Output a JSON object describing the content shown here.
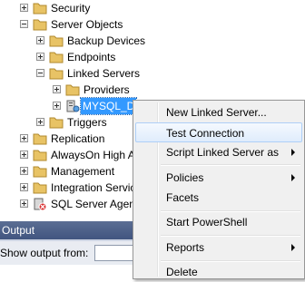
{
  "tree": {
    "items": [
      {
        "label": "Security",
        "expander": "plus",
        "icon": "folder-icon"
      },
      {
        "label": "Server Objects",
        "expander": "minus",
        "icon": "folder-icon"
      },
      {
        "label": "Backup Devices",
        "expander": "plus",
        "icon": "folder-icon"
      },
      {
        "label": "Endpoints",
        "expander": "plus",
        "icon": "folder-icon"
      },
      {
        "label": "Linked Servers",
        "expander": "minus",
        "icon": "folder-icon"
      },
      {
        "label": "Providers",
        "expander": "plus",
        "icon": "folder-icon"
      },
      {
        "label": "MYSQL_D",
        "expander": "plus",
        "icon": "linked-server-icon"
      },
      {
        "label": "Triggers",
        "expander": "plus",
        "icon": "folder-icon"
      },
      {
        "label": "Replication",
        "expander": "plus",
        "icon": "folder-icon"
      },
      {
        "label": "AlwaysOn High A",
        "expander": "plus",
        "icon": "folder-icon"
      },
      {
        "label": "Management",
        "expander": "plus",
        "icon": "folder-icon"
      },
      {
        "label": "Integration Servic",
        "expander": "plus",
        "icon": "folder-icon"
      },
      {
        "label": "SQL Server Agent",
        "expander": "plus",
        "icon": "sql-agent-icon"
      }
    ]
  },
  "output": {
    "title": "Output",
    "show_from_label": "Show output from:"
  },
  "context_menu": {
    "new_linked_server": "New Linked Server...",
    "test_connection": "Test Connection",
    "script_linked_server_as": "Script Linked Server as",
    "policies": "Policies",
    "facets": "Facets",
    "start_powershell": "Start PowerShell",
    "reports": "Reports",
    "delete": "Delete"
  },
  "colors": {
    "selection": "#3399ff",
    "menu_highlight": "#dfecfc",
    "folder": "#e8c365"
  }
}
